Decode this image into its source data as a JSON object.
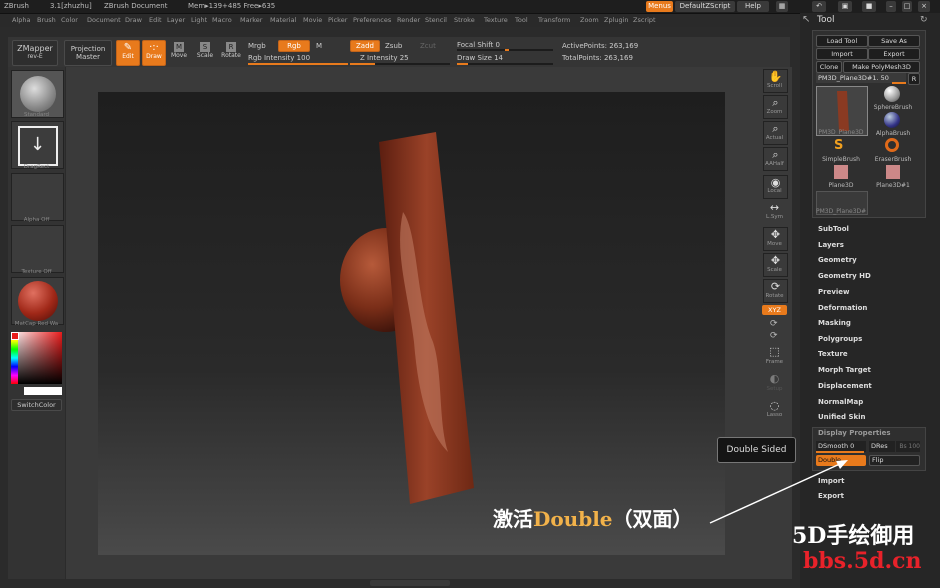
{
  "titlebar": {
    "app": "ZBrush",
    "version": "3.1[zhuzhu]",
    "document": "ZBrush Document",
    "mem": "Mem▸139+485 Free▸635",
    "menus_btn": "Menus",
    "script_btn": "DefaultZScript",
    "help_btn": "Help"
  },
  "menubar": [
    "Alpha",
    "Brush",
    "Color",
    "Document",
    "Draw",
    "Edit",
    "Layer",
    "Light",
    "Macro",
    "Marker",
    "Material",
    "Movie",
    "Picker",
    "Preferences",
    "Render",
    "Stencil",
    "Stroke",
    "Texture",
    "Tool",
    "Transform",
    "Zoom",
    "Zplugin",
    "Zscript"
  ],
  "shelf": {
    "zmapper": "ZMapper",
    "zmapper_sub": "rev-E",
    "projection": "Projection",
    "projection_sub": "Master",
    "edit": "Edit",
    "draw": "Draw",
    "move": "Move",
    "scale": "Scale",
    "rotate": "Rotate",
    "mrgb": "Mrgb",
    "rgb": "Rgb",
    "m": "M",
    "rgb_intensity": "Rgb Intensity 100",
    "zadd": "Zadd",
    "zsub": "Zsub",
    "zcut": "Zcut",
    "z_intensity": "Z Intensity 25",
    "focal_shift": "Focal Shift 0",
    "draw_size": "Draw Size 14",
    "active_points": "ActivePoints: 263,169",
    "total_points": "TotalPoints: 263,169",
    "rgb_intensity_value": 100,
    "z_intensity_value": 25,
    "draw_size_value": 14
  },
  "leftpanel": {
    "brush": "Standard",
    "stroke": "DragRect",
    "alpha": "Alpha Off",
    "texture": "Texture Off",
    "material": "MatCap Red Wa",
    "switch_color": "SwitchColor"
  },
  "righttools": {
    "scroll": "Scroll",
    "zoom": "Zoom",
    "actual": "Actual",
    "aahalf": "AAHalf",
    "local": "Local",
    "lsym": "L.Sym",
    "move": "Move",
    "scale": "Scale",
    "rotate": "Rotate",
    "xyz": "XYZ",
    "frame": "Frame",
    "setup": "Setup",
    "lasso": "Lasso"
  },
  "toolpanel": {
    "title": "Tool",
    "load_tool": "Load Tool",
    "save_as": "Save As",
    "import": "Import",
    "export": "Export",
    "clone": "Clone",
    "make_polymesh": "Make PolyMesh3D",
    "current_tool": "PM3D_Plane3D#1. 50",
    "r_btn": "R",
    "tools": [
      "PM3D_Plane3D",
      "SphereBrush",
      "AlphaBrush",
      "SimpleBrush",
      "EraserBrush",
      "Plane3D",
      "Plane3D#1",
      "PM3D_Plane3D#"
    ],
    "sections": [
      "SubTool",
      "Layers",
      "Geometry",
      "Geometry HD",
      "Preview",
      "Deformation",
      "Masking",
      "Polygroups",
      "Texture",
      "Morph Target",
      "Displacement",
      "NormalMap",
      "Unified Skin"
    ],
    "display_properties": "Display Properties",
    "dsmooth": "DSmooth 0",
    "dres": "DRes",
    "dres_value": "Bs 100",
    "double": "Double",
    "flip": "Flip",
    "import2": "Import",
    "export2": "Export"
  },
  "tooltip": "Double Sided",
  "callout": {
    "prefix": "激活",
    "highlight": "Double",
    "suffix": "（双面）"
  },
  "watermark": {
    "line1": "5D手绘御用",
    "line2": "bbs.5d.cn"
  },
  "colors": {
    "accent": "#e87a1c",
    "model": "#8a3a22",
    "watermark_red": "#e8222a"
  }
}
